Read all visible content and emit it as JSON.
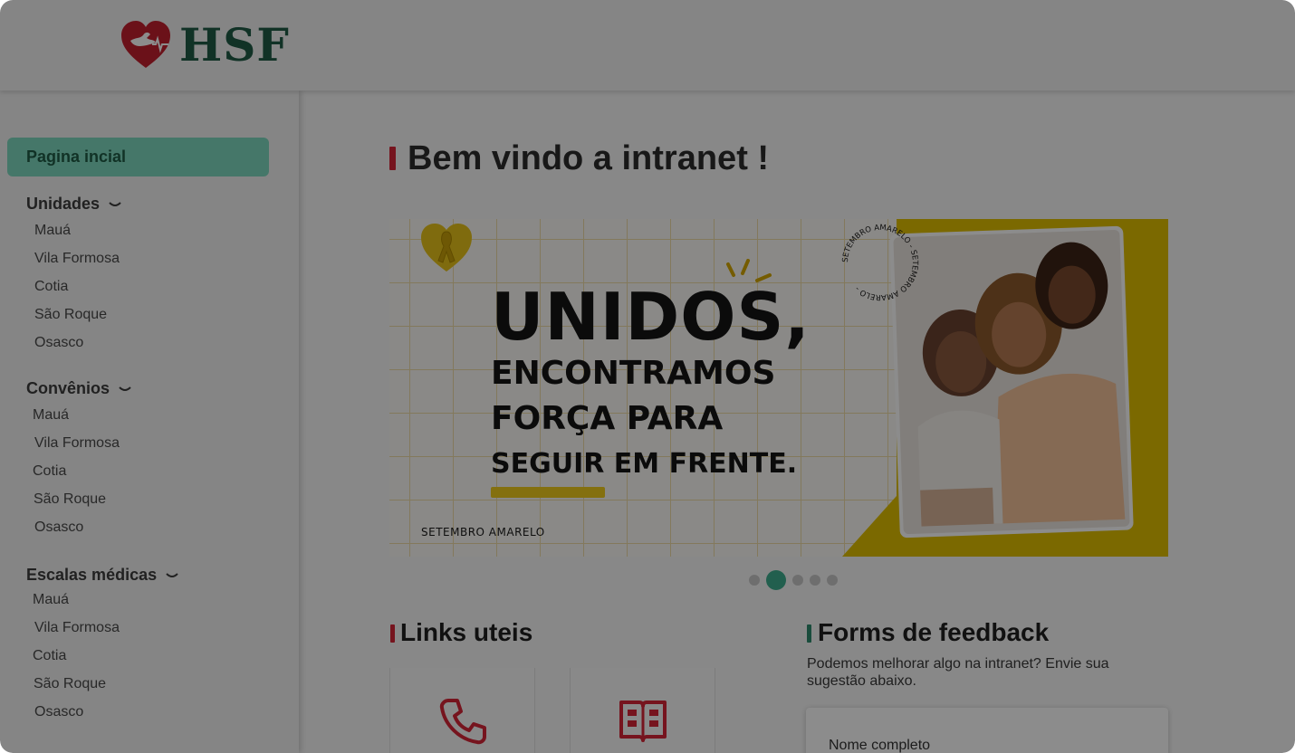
{
  "header": {
    "logo_text": "HSF",
    "logo_icon": "heart-dove-icon"
  },
  "sidebar": {
    "active_item": "Pagina incial",
    "sections": [
      {
        "label": "Unidades",
        "items": [
          "Mauá",
          "Vila Formosa",
          "Cotia",
          "São Roque",
          "Osasco"
        ]
      },
      {
        "label": "Convênios",
        "items": [
          "Mauá",
          "Vila Formosa",
          "Cotia",
          "São Roque",
          "Osasco"
        ]
      },
      {
        "label": "Escalas médicas",
        "items": [
          "Mauá",
          "Vila Formosa",
          "Cotia",
          "São Roque",
          "Osasco"
        ]
      }
    ]
  },
  "main": {
    "title": "Bem vindo a intranet !",
    "banner": {
      "headline": "UNIDOS,",
      "line2": "ENCONTRAMOS",
      "line3": "FORÇA PARA",
      "line4": "SEGUIR EM FRENTE.",
      "footer": "SETEMBRO AMARELO",
      "ring_text": "SETEMBRO AMARELO - SETEMBRO AMARELO -"
    },
    "carousel": {
      "count": 5,
      "active_index": 1
    },
    "links_section": {
      "title": "Links uteis",
      "cards": [
        {
          "icon": "phone-icon"
        },
        {
          "icon": "book-icon"
        }
      ]
    },
    "feedback_section": {
      "title": "Forms de feedback",
      "description": "Podemos melhorar algo na intranet? Envie sua sugestão abaixo.",
      "name_field_label": "Nome completo"
    }
  },
  "colors": {
    "brand_green": "#1f5b45",
    "accent_red": "#d72638",
    "active_teal": "#3fae8e",
    "banner_yellow": "#d6b200"
  }
}
